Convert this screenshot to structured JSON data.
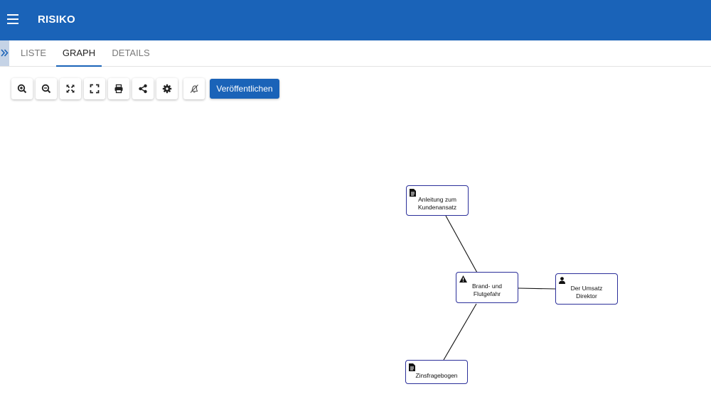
{
  "app": {
    "title": "RISIKO"
  },
  "tabs": [
    {
      "label": "LISTE",
      "active": false
    },
    {
      "label": "GRAPH",
      "active": true
    },
    {
      "label": "DETAILS",
      "active": false
    }
  ],
  "toolbar": {
    "buttons": [
      {
        "icon": "zoom-in-icon"
      },
      {
        "icon": "zoom-out-icon"
      },
      {
        "icon": "fit-view-icon"
      },
      {
        "icon": "fullscreen-icon"
      },
      {
        "icon": "print-icon"
      },
      {
        "icon": "share-icon"
      },
      {
        "icon": "settings-icon"
      },
      {
        "icon": "notifications-off-icon"
      }
    ],
    "publish_label": "Veröffentlichen"
  },
  "graph": {
    "nodes": [
      {
        "id": "n1",
        "type": "document",
        "icon": "document-icon",
        "label_lines": [
          "Anleitung zum",
          "Kundenansatz"
        ]
      },
      {
        "id": "n2",
        "type": "risk",
        "icon": "warning-icon",
        "label_lines": [
          "Brand- und",
          "Flutgefahr"
        ]
      },
      {
        "id": "n3",
        "type": "person",
        "icon": "person-icon",
        "label_lines": [
          "Der Umsatz",
          "Direktor"
        ]
      },
      {
        "id": "n4",
        "type": "document",
        "icon": "document-icon",
        "label_lines": [
          "Zinsfragebogen"
        ]
      }
    ],
    "edges": [
      {
        "from": "n1",
        "to": "n2"
      },
      {
        "from": "n2",
        "to": "n3"
      },
      {
        "from": "n2",
        "to": "n4"
      }
    ]
  },
  "colors": {
    "primary": "#1a63b8",
    "node_border": "#2b2f9a",
    "sidebar_toggle": "#c5d3e6"
  }
}
